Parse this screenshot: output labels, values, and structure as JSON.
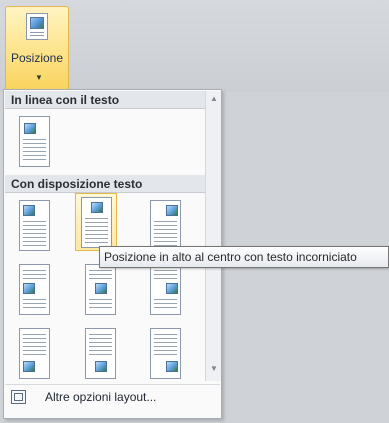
{
  "ribbon": {
    "position_button_label": "Posizione",
    "position_icon": "picture-position-icon"
  },
  "menu": {
    "inline_header": "In linea con il testo",
    "wrap_header": "Con disposizione testo",
    "footer_label": "Altre opzioni layout...",
    "footer_icon": "layout-options-icon"
  },
  "tooltip": {
    "text": "Posizione in alto al centro con testo incorniciato"
  },
  "colors": {
    "hover_highlight": "#fde8a4",
    "menu_background": "#fafafa",
    "section_header_background": "#e3e6ea"
  }
}
